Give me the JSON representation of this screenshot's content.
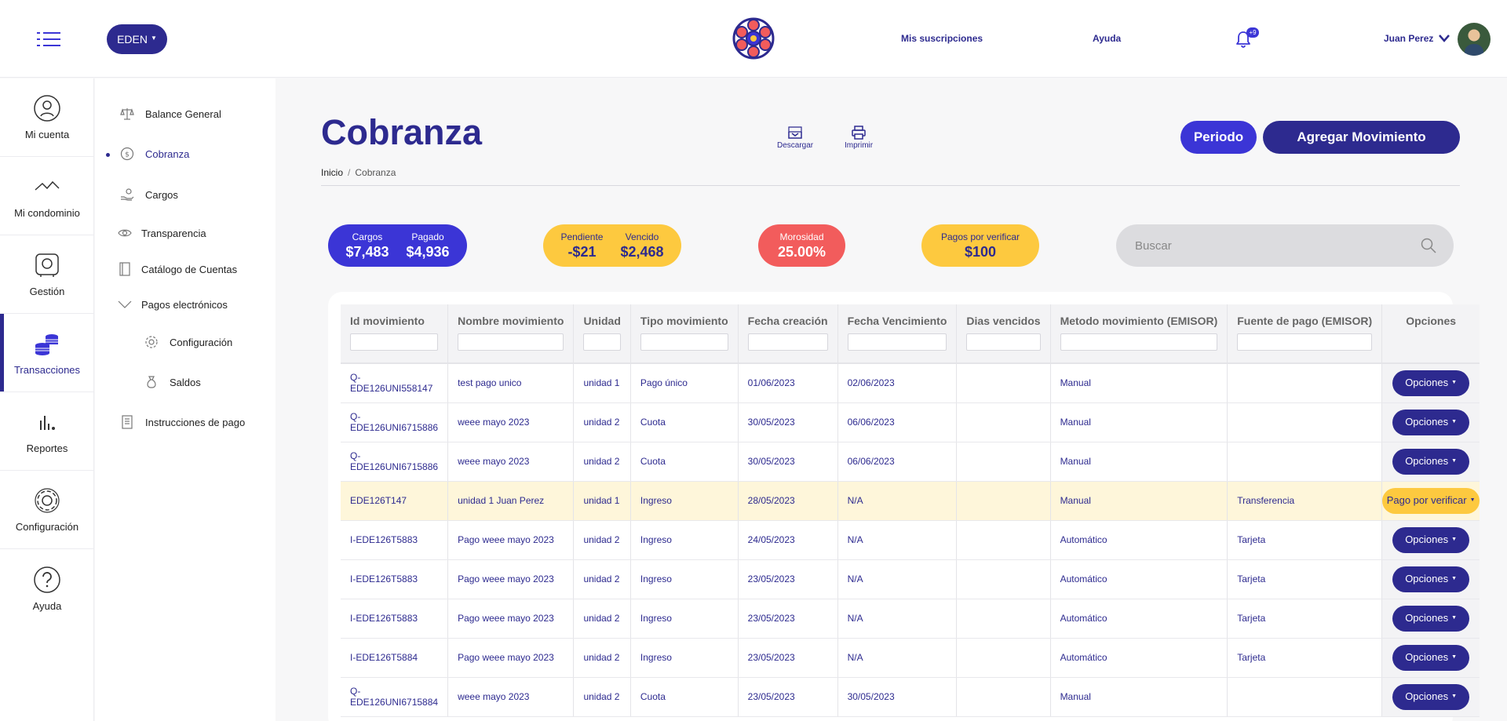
{
  "header": {
    "org_button": "EDEN",
    "links": [
      "Mis suscripciones",
      "Ayuda"
    ],
    "notifications_badge": "+9",
    "user_name": "Juan Perez"
  },
  "rail": [
    {
      "label": "Mi cuenta",
      "icon": "user-circle-icon"
    },
    {
      "label": "Mi condominio",
      "icon": "building-outline-icon"
    },
    {
      "label": "Gestión",
      "icon": "safe-box-icon"
    },
    {
      "label": "Transacciones",
      "icon": "coins-stack-icon",
      "active": true
    },
    {
      "label": "Reportes",
      "icon": "bar-chart-icon"
    },
    {
      "label": "Configuración",
      "icon": "gear-icon"
    },
    {
      "label": "Ayuda",
      "icon": "help-circle-icon"
    }
  ],
  "submenu": [
    {
      "label": "Balance General",
      "icon": "scale-icon"
    },
    {
      "label": "Cobranza",
      "icon": "coin-icon",
      "active": true
    },
    {
      "label": "Cargos",
      "icon": "hand-coin-icon"
    },
    {
      "label": "Transparencia",
      "icon": "eye-icon"
    },
    {
      "label": "Catálogo de Cuentas",
      "icon": "book-icon"
    },
    {
      "label": "Pagos electrónicos",
      "icon": "chevron-down-icon"
    },
    {
      "label": "Configuración",
      "icon": "gear-icon"
    },
    {
      "label": "Saldos",
      "icon": "money-bag-icon"
    },
    {
      "label": "Instrucciones de pago",
      "icon": "document-icon"
    }
  ],
  "page": {
    "title": "Cobranza",
    "breadcrumb": [
      "Inicio",
      "Cobranza"
    ],
    "tools": [
      "Descargar",
      "Imprimir"
    ],
    "btn_periodo": "Periodo",
    "btn_agregar": "Agregar Movimiento"
  },
  "stats": {
    "cargos_label": "Cargos",
    "cargos_value": "$7,483",
    "pagado_label": "Pagado",
    "pagado_value": "$4,936",
    "pendiente_label": "Pendiente",
    "pendiente_value": "-$21",
    "vencido_label": "Vencido",
    "vencido_value": "$2,468",
    "morosidad_label": "Morosidad",
    "morosidad_value": "25.00%",
    "pagos_label": "Pagos por verificar",
    "pagos_value": "$100"
  },
  "search": {
    "placeholder": "Buscar"
  },
  "table": {
    "columns": [
      "Id movimiento",
      "Nombre movimiento",
      "Unidad",
      "Tipo movimiento",
      "Fecha creación",
      "Fecha Vencimiento",
      "Dias vencidos",
      "Metodo movimiento (EMISOR)",
      "Fuente de pago (EMISOR)",
      "Opciones"
    ],
    "rows": [
      {
        "id": "Q-EDE126UNI558147",
        "nombre": "test pago unico",
        "unidad": "unidad 1",
        "tipo": "Pago único",
        "creacion": "01/06/2023",
        "vencimiento": "02/06/2023",
        "dias": "",
        "metodo": "Manual",
        "fuente": "",
        "opcion": "Opciones"
      },
      {
        "id": "Q-EDE126UNI6715886",
        "nombre": "weee mayo 2023",
        "unidad": "unidad 2",
        "tipo": "Cuota",
        "creacion": "30/05/2023",
        "vencimiento": "06/06/2023",
        "dias": "",
        "metodo": "Manual",
        "fuente": "",
        "opcion": "Opciones"
      },
      {
        "id": "Q-EDE126UNI6715886",
        "nombre": "weee mayo 2023",
        "unidad": "unidad 2",
        "tipo": "Cuota",
        "creacion": "30/05/2023",
        "vencimiento": "06/06/2023",
        "dias": "",
        "metodo": "Manual",
        "fuente": "",
        "opcion": "Opciones"
      },
      {
        "id": "EDE126T147",
        "nombre": "unidad 1 Juan Perez",
        "unidad": "unidad 1",
        "tipo": "Ingreso",
        "creacion": "28/05/2023",
        "vencimiento": "N/A",
        "dias": "",
        "metodo": "Manual",
        "fuente": "Transferencia",
        "opcion": "Pago por verificar",
        "highlight": true
      },
      {
        "id": "I-EDE126T5883",
        "nombre": "Pago weee mayo 2023",
        "unidad": "unidad 2",
        "tipo": "Ingreso",
        "creacion": "24/05/2023",
        "vencimiento": "N/A",
        "dias": "",
        "metodo": "Automático",
        "fuente": "Tarjeta",
        "opcion": "Opciones"
      },
      {
        "id": "I-EDE126T5883",
        "nombre": "Pago weee mayo 2023",
        "unidad": "unidad 2",
        "tipo": "Ingreso",
        "creacion": "23/05/2023",
        "vencimiento": "N/A",
        "dias": "",
        "metodo": "Automático",
        "fuente": "Tarjeta",
        "opcion": "Opciones"
      },
      {
        "id": "I-EDE126T5883",
        "nombre": "Pago weee mayo 2023",
        "unidad": "unidad 2",
        "tipo": "Ingreso",
        "creacion": "23/05/2023",
        "vencimiento": "N/A",
        "dias": "",
        "metodo": "Automático",
        "fuente": "Tarjeta",
        "opcion": "Opciones"
      },
      {
        "id": "I-EDE126T5884",
        "nombre": "Pago weee mayo 2023",
        "unidad": "unidad 2",
        "tipo": "Ingreso",
        "creacion": "23/05/2023",
        "vencimiento": "N/A",
        "dias": "",
        "metodo": "Automático",
        "fuente": "Tarjeta",
        "opcion": "Opciones"
      },
      {
        "id": "Q-EDE126UNI6715884",
        "nombre": "weee mayo 2023",
        "unidad": "unidad 2",
        "tipo": "Cuota",
        "creacion": "23/05/2023",
        "vencimiento": "30/05/2023",
        "dias": "",
        "metodo": "Manual",
        "fuente": "",
        "opcion": "Opciones"
      }
    ]
  },
  "colors": {
    "primary": "#2d2a8f",
    "accent": "#3b35d6",
    "warning": "#fdc93f",
    "danger": "#f25c5c"
  }
}
